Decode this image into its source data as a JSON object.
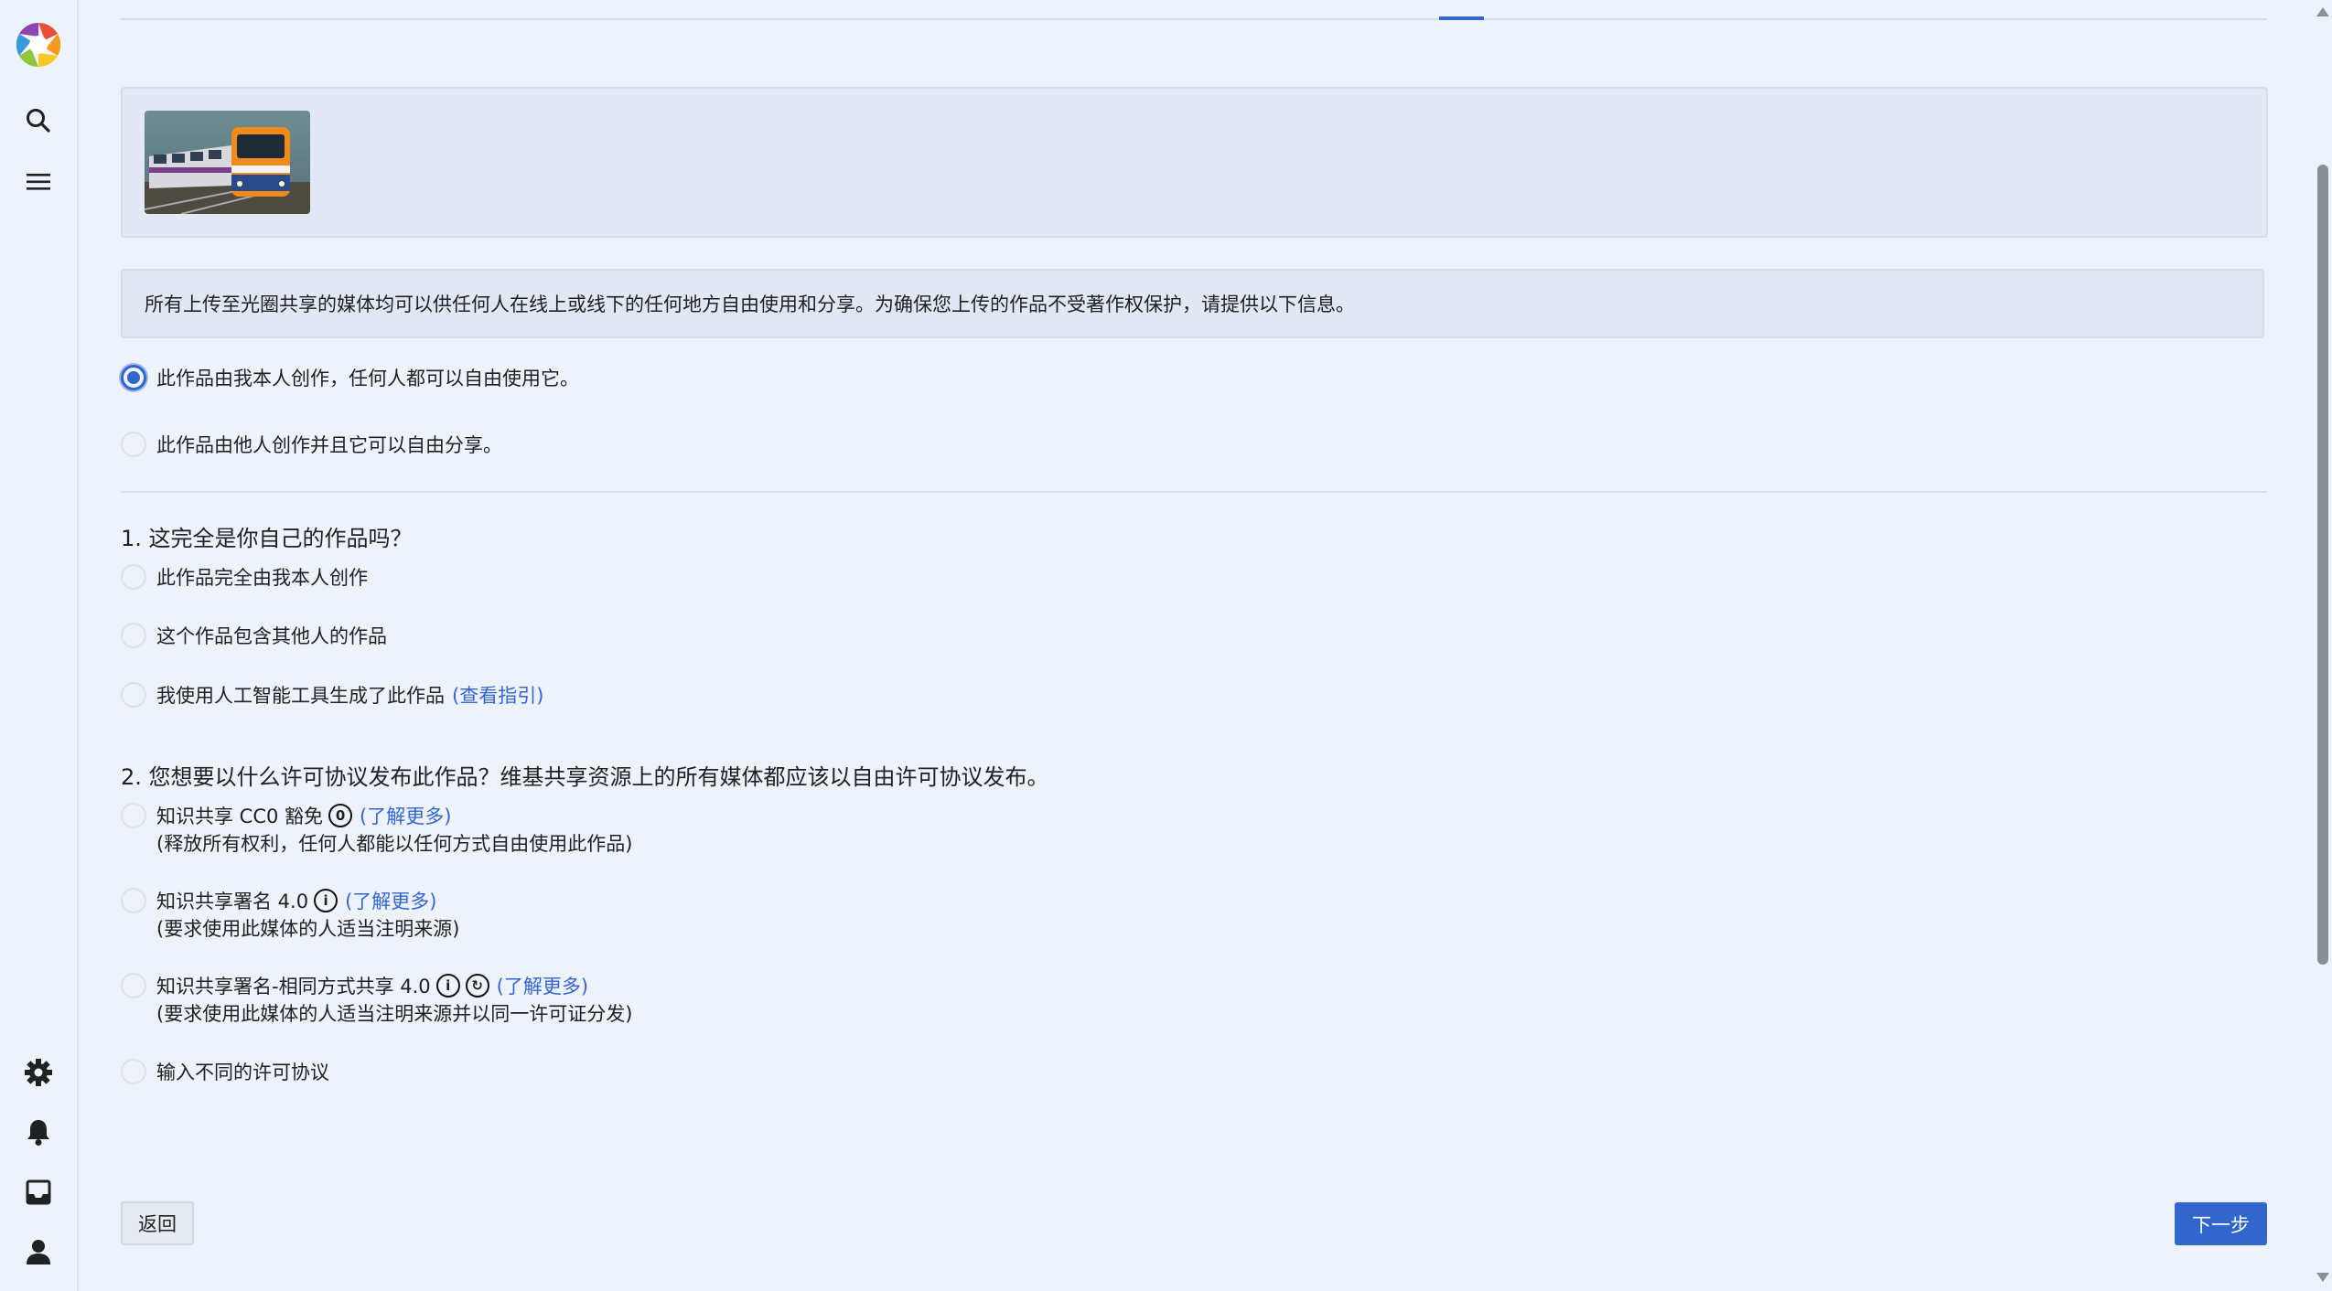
{
  "sidebar": {
    "icons": [
      "logo-icon",
      "search-icon",
      "menu-icon",
      "settings-icon",
      "bell-icon",
      "inbox-icon",
      "user-icon"
    ]
  },
  "notice": "所有上传至光圈共享的媒体均可以供任何人在线上或线下的任何地方自由使用和分享。为确保您上传的作品不受著作权保护，请提供以下信息。",
  "ownership": {
    "own_label": "此作品由我本人创作，任何人都可以自由使用它。",
    "other_label": "此作品由他人创作并且它可以自由分享。",
    "selected": "own"
  },
  "q1": {
    "title": "1. 这完全是你自己的作品吗？",
    "opt1": "此作品完全由我本人创作",
    "opt2": "这个作品包含其他人的作品",
    "opt3": "我使用人工智能工具生成了此作品",
    "opt3_link": "(查看指引)"
  },
  "q2": {
    "title": "2. 您想要以什么许可协议发布此作品？维基共享资源上的所有媒体都应该以自由许可协议发布。",
    "opt1_label": "知识共享 CC0 豁免",
    "opt1_link": "(了解更多)",
    "opt1_desc": "(释放所有权利，任何人都能以任何方式自由使用此作品)",
    "opt2_label": "知识共享署名 4.0",
    "opt2_link": "(了解更多)",
    "opt2_desc": "(要求使用此媒体的人适当注明来源)",
    "opt3_label": "知识共享署名-相同方式共享 4.0",
    "opt3_link": "(了解更多)",
    "opt3_desc": "(要求使用此媒体的人适当注明来源并以同一许可证分发)",
    "opt4_label": "输入不同的许可协议"
  },
  "buttons": {
    "back": "返回",
    "next": "下一步"
  },
  "colors": {
    "accent": "#3366cc",
    "background": "#eef2fa"
  }
}
